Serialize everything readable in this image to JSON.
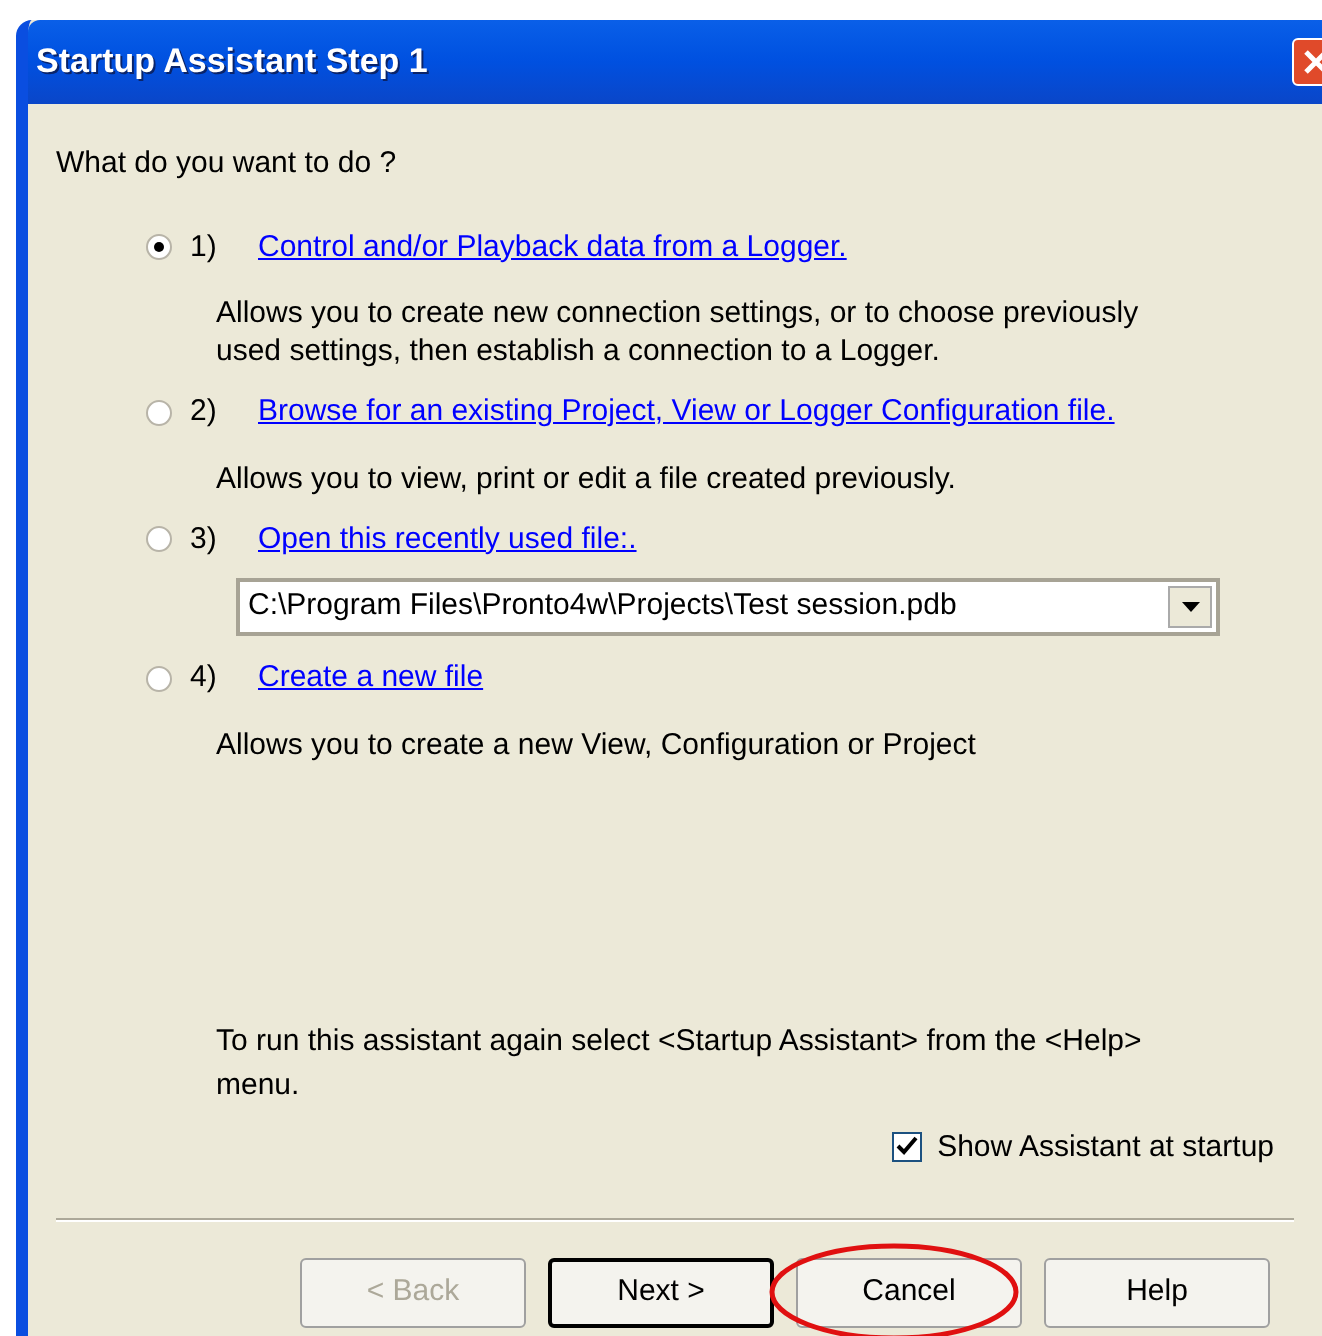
{
  "window": {
    "title": "Startup Assistant Step 1"
  },
  "prompt": "What do you want to do ?",
  "options": [
    {
      "number": "1)",
      "link": "Control and/or Playback data from a Logger.",
      "selected": true,
      "description": "Allows you to create new connection settings, or to choose previously used settings, then establish a connection to a Logger."
    },
    {
      "number": "2)",
      "link": "Browse for an existing Project, View or Logger Configuration file.",
      "selected": false,
      "description": "Allows you to view, print or edit a file created previously."
    },
    {
      "number": "3)",
      "link": "Open this recently used file:.",
      "selected": false,
      "combo": {
        "value": "C:\\Program Files\\Pronto4w\\Projects\\Test session.pdb"
      }
    },
    {
      "number": "4)",
      "link": "Create a new file",
      "selected": false,
      "description": "Allows you to create a new View, Configuration or Project"
    }
  ],
  "hint": "To run this assistant again select <Startup Assistant> from the <Help> menu.",
  "show_at_startup": {
    "label": "Show Assistant at startup",
    "checked": true
  },
  "buttons": [
    {
      "label": "< Back",
      "disabled": true,
      "default": false,
      "highlighted": false
    },
    {
      "label": "Next >",
      "disabled": false,
      "default": true,
      "highlighted": false
    },
    {
      "label": "Cancel",
      "disabled": false,
      "default": false,
      "highlighted": true
    },
    {
      "label": "Help",
      "disabled": false,
      "default": false,
      "highlighted": false
    }
  ]
}
